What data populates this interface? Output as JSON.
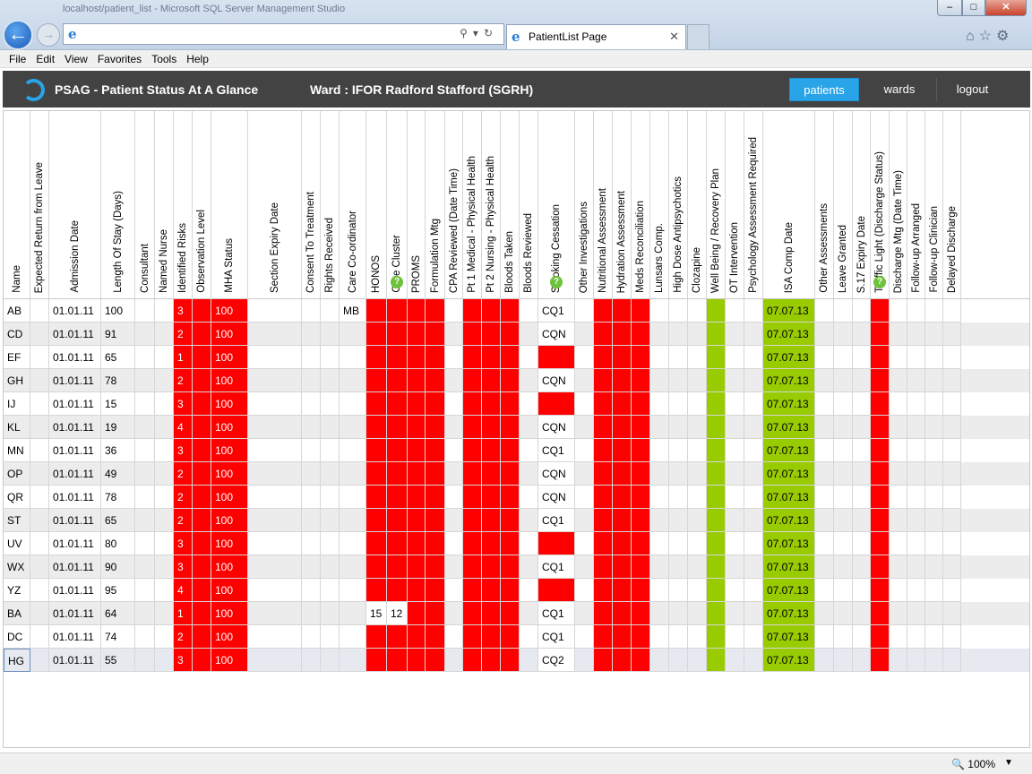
{
  "browser": {
    "window_title": "localhost/patient_list - Microsoft SQL Server Management Studio",
    "address_value": "",
    "tab_title": "PatientList Page",
    "zoom": "100%",
    "menu": [
      "File",
      "Edit",
      "View",
      "Favorites",
      "Tools",
      "Help"
    ]
  },
  "app": {
    "title": "PSAG - Patient Status At A Glance",
    "ward": "Ward : IFOR Radford Stafford (SGRH)",
    "nav": {
      "patients": "patients",
      "wards": "wards",
      "logout": "logout"
    },
    "colors": {
      "header_bg": "#434343",
      "accent": "#2aa4e8",
      "alert": "#ff0000",
      "ok": "#99cc00"
    }
  },
  "columns": [
    {
      "key": "name",
      "label": "Name"
    },
    {
      "key": "ret",
      "label": "Expected Return from Leave"
    },
    {
      "key": "adm",
      "label": "Admission Date"
    },
    {
      "key": "los",
      "label": "Length Of Stay (Days)"
    },
    {
      "key": "cons",
      "label": "Consultant"
    },
    {
      "key": "nurse",
      "label": "Named Nurse"
    },
    {
      "key": "risk",
      "label": "Identified Risks"
    },
    {
      "key": "obs",
      "label": "Observation Level"
    },
    {
      "key": "mha",
      "label": "MHA Status"
    },
    {
      "key": "sed",
      "label": "Section Expiry Date"
    },
    {
      "key": "ctt",
      "label": "Consent To Treatment"
    },
    {
      "key": "rr",
      "label": "Rights Received"
    },
    {
      "key": "cc",
      "label": "Care Co-ordinator"
    },
    {
      "key": "hon",
      "label": "HONOS"
    },
    {
      "key": "clu",
      "label": "Care Cluster",
      "help": true
    },
    {
      "key": "prm",
      "label": "PROMS"
    },
    {
      "key": "fm",
      "label": "Formulation Mtg"
    },
    {
      "key": "cpa",
      "label": "CPA Reviewed (Date Time)"
    },
    {
      "key": "pt1",
      "label": "Pt 1 Medical - Physical Health"
    },
    {
      "key": "pt2",
      "label": "Pt 2 Nursing - Physical Health"
    },
    {
      "key": "bt",
      "label": "Bloods Taken"
    },
    {
      "key": "br",
      "label": "Bloods Reviewed"
    },
    {
      "key": "sc",
      "label": "Smoking Cessation",
      "help": true
    },
    {
      "key": "oi",
      "label": "Other Investigations"
    },
    {
      "key": "na",
      "label": "Nutritional Assessment"
    },
    {
      "key": "ha",
      "label": "Hydration Assessment"
    },
    {
      "key": "mr",
      "label": "Meds Reconciliation"
    },
    {
      "key": "lc",
      "label": "Lunsars Comp."
    },
    {
      "key": "hd",
      "label": "High Dose Antipsychotics"
    },
    {
      "key": "clz",
      "label": "Clozapine"
    },
    {
      "key": "wb",
      "label": "Well Being / Recovery Plan"
    },
    {
      "key": "ot",
      "label": "OT Intervention"
    },
    {
      "key": "psy",
      "label": "Psychology Assessment Required"
    },
    {
      "key": "isa",
      "label": "ISA Comp Date"
    },
    {
      "key": "oa",
      "label": "Other Assessments"
    },
    {
      "key": "lg",
      "label": "Leave Granted"
    },
    {
      "key": "s17",
      "label": "S.17 Expiry Date"
    },
    {
      "key": "tl",
      "label": "Traffic Light (Discharge Status)",
      "help": true
    },
    {
      "key": "dm",
      "label": "Discharge Mtg (Date Time)"
    },
    {
      "key": "fa",
      "label": "Follow-up Arranged"
    },
    {
      "key": "fc",
      "label": "Follow-up Clinician"
    },
    {
      "key": "dd",
      "label": "Delayed Discharge"
    }
  ],
  "patients": [
    {
      "name": "AB",
      "adm": "01.01.11",
      "los": "100",
      "risk": "3",
      "mha": "100",
      "cc": "MB",
      "sc": "CQ1",
      "isa": "07.07.13"
    },
    {
      "name": "CD",
      "adm": "01.01.11",
      "los": "91",
      "risk": "2",
      "mha": "100",
      "cc": "",
      "sc": "CQN",
      "isa": "07.07.13"
    },
    {
      "name": "EF",
      "adm": "01.01.11",
      "los": "65",
      "risk": "1",
      "mha": "100",
      "cc": "",
      "sc": "",
      "isa": "07.07.13"
    },
    {
      "name": "GH",
      "adm": "01.01.11",
      "los": "78",
      "risk": "2",
      "mha": "100",
      "cc": "",
      "sc": "CQN",
      "isa": "07.07.13"
    },
    {
      "name": "IJ",
      "adm": "01.01.11",
      "los": "15",
      "risk": "3",
      "mha": "100",
      "cc": "",
      "sc": "",
      "isa": "07.07.13"
    },
    {
      "name": "KL",
      "adm": "01.01.11",
      "los": "19",
      "risk": "4",
      "mha": "100",
      "cc": "",
      "sc": "CQN",
      "isa": "07.07.13"
    },
    {
      "name": "MN",
      "adm": "01.01.11",
      "los": "36",
      "risk": "3",
      "mha": "100",
      "cc": "",
      "sc": "CQ1",
      "isa": "07.07.13"
    },
    {
      "name": "OP",
      "adm": "01.01.11",
      "los": "49",
      "risk": "2",
      "mha": "100",
      "cc": "",
      "sc": "CQN",
      "isa": "07.07.13"
    },
    {
      "name": "QR",
      "adm": "01.01.11",
      "los": "78",
      "risk": "2",
      "mha": "100",
      "cc": "",
      "sc": "CQN",
      "isa": "07.07.13"
    },
    {
      "name": "ST",
      "adm": "01.01.11",
      "los": "65",
      "risk": "2",
      "mha": "100",
      "cc": "",
      "sc": "CQ1",
      "isa": "07.07.13"
    },
    {
      "name": "UV",
      "adm": "01.01.11",
      "los": "80",
      "risk": "3",
      "mha": "100",
      "cc": "",
      "sc": "",
      "isa": "07.07.13"
    },
    {
      "name": "WX",
      "adm": "01.01.11",
      "los": "90",
      "risk": "3",
      "mha": "100",
      "cc": "",
      "sc": "CQ1",
      "isa": "07.07.13"
    },
    {
      "name": "YZ",
      "adm": "01.01.11",
      "los": "95",
      "risk": "4",
      "mha": "100",
      "cc": "",
      "sc": "",
      "isa": "07.07.13"
    },
    {
      "name": "BA",
      "adm": "01.01.11",
      "los": "64",
      "risk": "1",
      "mha": "100",
      "cc": "",
      "hon": "15",
      "clu": "12",
      "sc": "CQ1",
      "isa": "07.07.13"
    },
    {
      "name": "DC",
      "adm": "01.01.11",
      "los": "74",
      "risk": "2",
      "mha": "100",
      "cc": "",
      "sc": "CQ1",
      "isa": "07.07.13"
    },
    {
      "name": "HG",
      "adm": "01.01.11",
      "los": "55",
      "risk": "3",
      "mha": "100",
      "cc": "",
      "sc": "CQ2",
      "isa": "07.07.13"
    }
  ]
}
